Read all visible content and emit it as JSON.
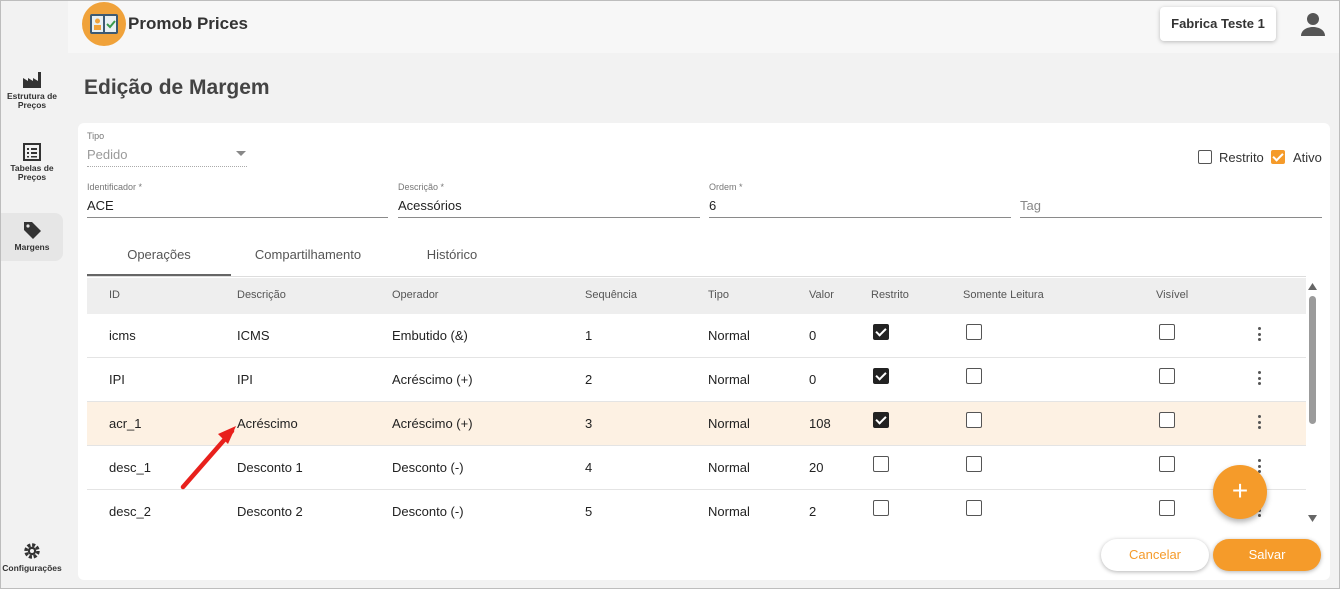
{
  "app": {
    "title": "Promob Prices",
    "company": "Fabrica Teste 1"
  },
  "sidebar": {
    "items": [
      {
        "label": "Estrutura de Preços",
        "icon": "factory-icon"
      },
      {
        "label": "Tabelas de Preços",
        "icon": "list-table-icon"
      },
      {
        "label": "Margens",
        "icon": "tag-icon"
      },
      {
        "label": "Configurações",
        "icon": "gear-icon"
      }
    ]
  },
  "page": {
    "title": "Edição de Margem"
  },
  "form": {
    "tipo": {
      "label": "Tipo",
      "value": "Pedido"
    },
    "identificador": {
      "label": "Identificador *",
      "value": "ACE"
    },
    "descricao": {
      "label": "Descrição *",
      "value": "Acessórios"
    },
    "ordem": {
      "label": "Ordem *",
      "value": "6"
    },
    "tag": {
      "placeholder": "Tag"
    },
    "restrito": {
      "label": "Restrito",
      "checked": false
    },
    "ativo": {
      "label": "Ativo",
      "checked": true
    }
  },
  "tabs": [
    {
      "label": "Operações",
      "active": true
    },
    {
      "label": "Compartilhamento",
      "active": false
    },
    {
      "label": "Histórico",
      "active": false
    }
  ],
  "table": {
    "columns": [
      "ID",
      "Descrição",
      "Operador",
      "Sequência",
      "Tipo",
      "Valor",
      "Restrito",
      "Somente Leitura",
      "Visível"
    ],
    "rows": [
      {
        "id": "icms",
        "descricao": "ICMS",
        "operador": "Embutido (&)",
        "sequencia": "1",
        "tipo": "Normal",
        "valor": "0",
        "restrito": true,
        "somente_leitura": false,
        "visivel": false
      },
      {
        "id": "IPI",
        "descricao": "IPI",
        "operador": "Acréscimo (+)",
        "sequencia": "2",
        "tipo": "Normal",
        "valor": "0",
        "restrito": true,
        "somente_leitura": false,
        "visivel": false
      },
      {
        "id": "acr_1",
        "descricao": "Acréscimo",
        "operador": "Acréscimo (+)",
        "sequencia": "3",
        "tipo": "Normal",
        "valor": "108",
        "restrito": true,
        "somente_leitura": false,
        "visivel": false
      },
      {
        "id": "desc_1",
        "descricao": "Desconto 1",
        "operador": "Desconto (-)",
        "sequencia": "4",
        "tipo": "Normal",
        "valor": "20",
        "restrito": false,
        "somente_leitura": false,
        "visivel": false
      },
      {
        "id": "desc_2",
        "descricao": "Desconto 2",
        "operador": "Desconto (-)",
        "sequencia": "5",
        "tipo": "Normal",
        "valor": "2",
        "restrito": false,
        "somente_leitura": false,
        "visivel": false
      }
    ]
  },
  "actions": {
    "fab_label": "+",
    "cancel_label": "Cancelar",
    "save_label": "Salvar"
  },
  "colors": {
    "accent": "#f59b2a",
    "highlight_row": "#fdf1e3",
    "annotation_arrow": "#e8201c"
  }
}
